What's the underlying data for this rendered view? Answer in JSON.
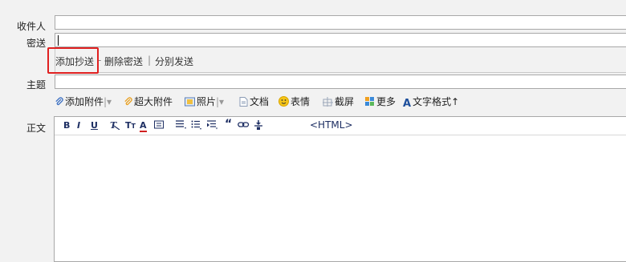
{
  "labels": {
    "recipient": "收件人",
    "bcc": "密送",
    "subject": "主题",
    "body": "正文"
  },
  "fields": {
    "recipient_value": "",
    "bcc_value": "",
    "subject_value": ""
  },
  "bcc_toolbar": {
    "add_cc": "添加抄送",
    "separator1": "-",
    "delete_bcc": "删除密送",
    "separator2": "|",
    "split_send": "分别发送"
  },
  "attach_toolbar": {
    "add_attachment": "添加附件",
    "super_attachment": "超大附件",
    "photo": "照片",
    "document": "文档",
    "emoji": "表情",
    "screenshot": "截屏",
    "more": "更多",
    "text_format": "文字格式",
    "dropdown_sep": "|▾",
    "text_format_arrow": "↑"
  },
  "format_toolbar": {
    "bold": "B",
    "italic": "I",
    "underline": "U",
    "font_family": "T",
    "font_size": "T",
    "font_color": "A",
    "quote": "“",
    "html_mode": "<HTML>"
  },
  "colors": {
    "highlight": "#e02020",
    "icon_blue": "#1e2f63",
    "background": "#f2f2f2"
  }
}
